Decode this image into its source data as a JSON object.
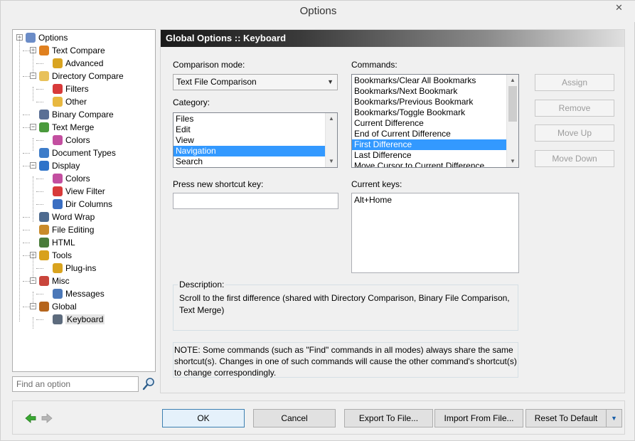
{
  "window": {
    "title": "Options",
    "close_glyph": "✕"
  },
  "tree": {
    "items": [
      {
        "label": "Options",
        "icon": "gear-icon"
      },
      {
        "label": "Text Compare",
        "icon": "text-compare-icon"
      },
      {
        "label": "Advanced",
        "icon": "wand-icon"
      },
      {
        "label": "Directory Compare",
        "icon": "folder-compare-icon"
      },
      {
        "label": "Filters",
        "icon": "filter-icon"
      },
      {
        "label": "Other",
        "icon": "folder-icon"
      },
      {
        "label": "Binary Compare",
        "icon": "binary-icon"
      },
      {
        "label": "Text Merge",
        "icon": "merge-icon"
      },
      {
        "label": "Colors",
        "icon": "palette-icon"
      },
      {
        "label": "Document Types",
        "icon": "document-types-icon"
      },
      {
        "label": "Display",
        "icon": "monitor-icon"
      },
      {
        "label": "Colors",
        "icon": "palette-icon"
      },
      {
        "label": "View Filter",
        "icon": "filter-icon"
      },
      {
        "label": "Dir Columns",
        "icon": "columns-icon"
      },
      {
        "label": "Word Wrap",
        "icon": "word-wrap-icon"
      },
      {
        "label": "File Editing",
        "icon": "edit-icon"
      },
      {
        "label": "HTML",
        "icon": "html-icon"
      },
      {
        "label": "Tools",
        "icon": "key-icon"
      },
      {
        "label": "Plug-ins",
        "icon": "plugin-icon"
      },
      {
        "label": "Misc",
        "icon": "misc-icon"
      },
      {
        "label": "Messages",
        "icon": "messages-icon"
      },
      {
        "label": "Global",
        "icon": "global-icon"
      },
      {
        "label": "Keyboard",
        "icon": "keyboard-icon"
      }
    ]
  },
  "search": {
    "placeholder": "Find an option"
  },
  "panel": {
    "header": "Global Options :: Keyboard",
    "comparison_mode_label": "Comparison mode:",
    "comparison_mode_value": "Text File Comparison",
    "category_label": "Category:",
    "categories": [
      "Files",
      "Edit",
      "View",
      "Navigation",
      "Search"
    ],
    "selected_category": "Navigation",
    "commands_label": "Commands:",
    "commands": [
      "Bookmarks/Clear All Bookmarks",
      "Bookmarks/Next Bookmark",
      "Bookmarks/Previous Bookmark",
      "Bookmarks/Toggle Bookmark",
      "Current Difference",
      "End of Current Difference",
      "First Difference",
      "Last Difference",
      "Move Cursor to Current Difference"
    ],
    "selected_command": "First Difference",
    "buttons": {
      "assign": "Assign",
      "remove": "Remove",
      "move_up": "Move Up",
      "move_down": "Move Down"
    },
    "shortcut_label": "Press new shortcut key:",
    "shortcut_value": "",
    "current_keys_label": "Current keys:",
    "current_keys": [
      "Alt+Home"
    ],
    "description_label": "Description:",
    "description": "Scroll to the first difference (shared with Directory Comparison, Binary File Comparison, Text Merge)",
    "note": "NOTE: Some commands (such as \"Find\" commands in all modes) always share the same shortcut(s). Changes in one of such commands will cause the other command's shortcut(s) to change correspondingly."
  },
  "footer": {
    "ok": "OK",
    "cancel": "Cancel",
    "export": "Export To File...",
    "import": "Import From File...",
    "reset": "Reset To Default"
  }
}
